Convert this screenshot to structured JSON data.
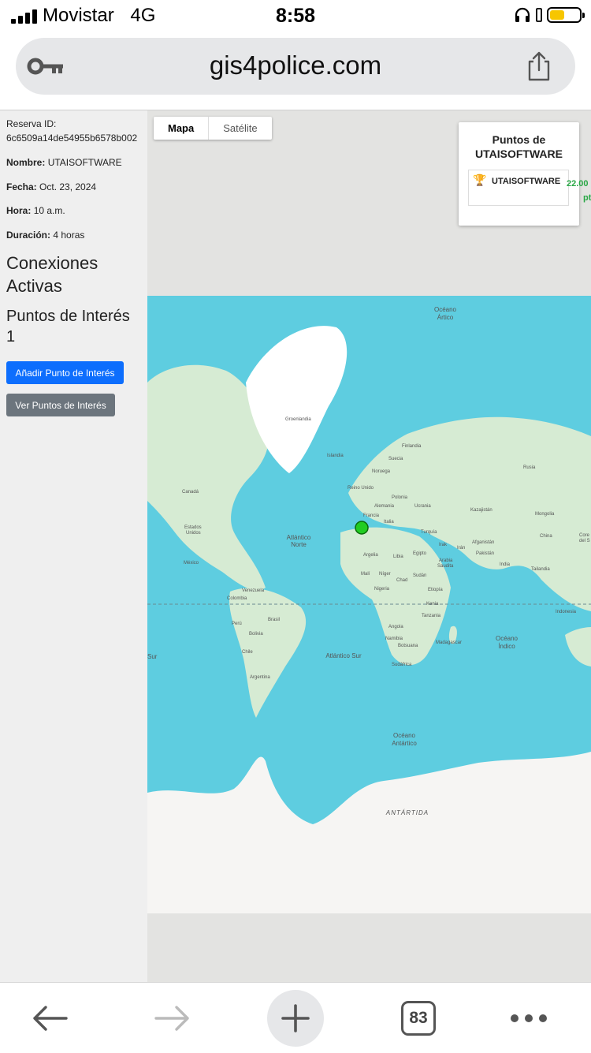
{
  "status_bar": {
    "carrier": "Movistar",
    "network": "4G",
    "time": "8:58"
  },
  "browser": {
    "url": "gis4police.com",
    "tab_count": "83",
    "icons": [
      "key-icon",
      "share-icon",
      "back-arrow-icon",
      "forward-arrow-icon",
      "plus-icon",
      "more-icon"
    ]
  },
  "sidebar": {
    "reserva_label": "Reserva ID:",
    "reserva_id": "6c6509a14de54955b6578b002",
    "nombre_label": "Nombre:",
    "nombre": "UTAISOFTWARE",
    "fecha_label": "Fecha:",
    "fecha": "Oct. 23, 2024",
    "hora_label": "Hora:",
    "hora": "10 a.m.",
    "duracion_label": "Duración:",
    "duracion": "4 horas",
    "conexiones_heading": "Conexiones Activas",
    "puntos_heading": "Puntos de Interés",
    "puntos_count": "1",
    "add_button": "Añadir Punto de Interés",
    "view_button": "Ver Puntos de Interés"
  },
  "map": {
    "type_active": "Mapa",
    "type_other": "Satélite",
    "ocean_color": "#5ecde0",
    "land_color": "#d6ebd3",
    "marker_color": "#22cc22",
    "labels": {
      "oceano_artico_1": "Océano",
      "oceano_artico_2": "Ártico",
      "groenlandia": "Groenlandia",
      "islandia": "Islandia",
      "finlandia": "Finlandia",
      "suecia": "Suecia",
      "noruega": "Noruega",
      "reino_unido": "Reino Unido",
      "polonia": "Polonia",
      "alemania": "Alemania",
      "ucrania": "Ucrania",
      "francia": "Francia",
      "italia": "Italia",
      "rusia": "Rusia",
      "kazajistan": "Kazajistán",
      "mongolia": "Mongolia",
      "canada": "Canadá",
      "estados_unidos_1": "Estados",
      "estados_unidos_2": "Unidos",
      "atlantico_norte_1": "Atlántico",
      "atlantico_norte_2": "Norte",
      "turquia": "Turquía",
      "irak": "Irak",
      "iran": "Irán",
      "afganistan": "Afganistán",
      "pakistan": "Pakistán",
      "china": "China",
      "corea_1": "Core",
      "corea_2": "del S",
      "mexico": "México",
      "argelia": "Argelia",
      "libia": "Libia",
      "egipto": "Egipto",
      "arabia_1": "Arabia",
      "arabia_2": "Saudita",
      "india": "India",
      "tailandia": "Tailandia",
      "mali": "Malí",
      "niger": "Níger",
      "chad": "Chad",
      "sudan": "Sudán",
      "venezuela": "Venezuela",
      "colombia": "Colombia",
      "nigeria": "Nigeria",
      "etiopia": "Etiopía",
      "kenia": "Kenia",
      "tanzania": "Tanzania",
      "indonesia": "Indonesia",
      "peru": "Perú",
      "brasil": "Brasil",
      "bolivia": "Bolivia",
      "angola": "Angola",
      "namibia": "Namibia",
      "botsuana": "Botsuana",
      "madagascar": "Madagascar",
      "oceano_indico_1": "Océano",
      "oceano_indico_2": "Índico",
      "chile": "Chile",
      "atlantico_sur": "Atlántico Sur",
      "sur": "Sur",
      "sudafrica": "Sudáfrica",
      "argentina": "Argentina",
      "oceano_antartico_1": "Océano",
      "oceano_antartico_2": "Antártico",
      "antartida": "ANTÁRTIDA"
    }
  },
  "scoreboard": {
    "title_line1": "Puntos de",
    "title_line2": "UTAISOFTWARE",
    "player": "UTAISOFTWARE",
    "points": "22.00",
    "points_unit": "pts"
  }
}
